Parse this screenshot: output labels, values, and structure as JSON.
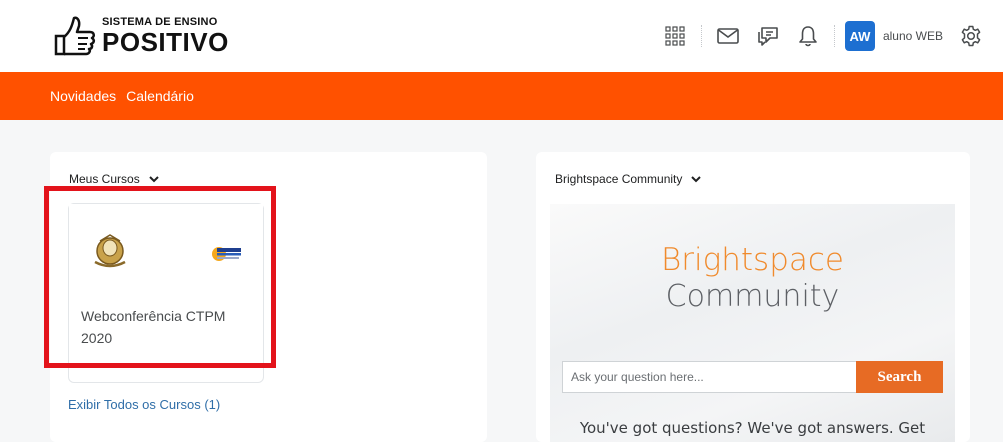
{
  "header": {
    "logo_line1": "SISTEMA DE ENSINO",
    "logo_line2": "POSITIVO",
    "avatar_initials": "AW",
    "username": "aluno WEB"
  },
  "nav": {
    "items": [
      {
        "label": "Novidades"
      },
      {
        "label": "Calendário"
      }
    ]
  },
  "my_courses": {
    "title": "Meus Cursos",
    "course_name": "Webconferência CTPM 2020",
    "view_all": "Exibir Todos os Cursos (1)"
  },
  "community": {
    "title": "Brightspace Community",
    "heading1": "Brightspace",
    "heading2": "Community",
    "search_placeholder": "Ask your question here...",
    "search_button": "Search",
    "blurb": "You've got questions? We've got answers. Get"
  },
  "colors": {
    "nav_background": "#ff5100",
    "highlight": "#e3131b",
    "avatar": "#1d6fd1",
    "search_button": "#e76b24"
  }
}
